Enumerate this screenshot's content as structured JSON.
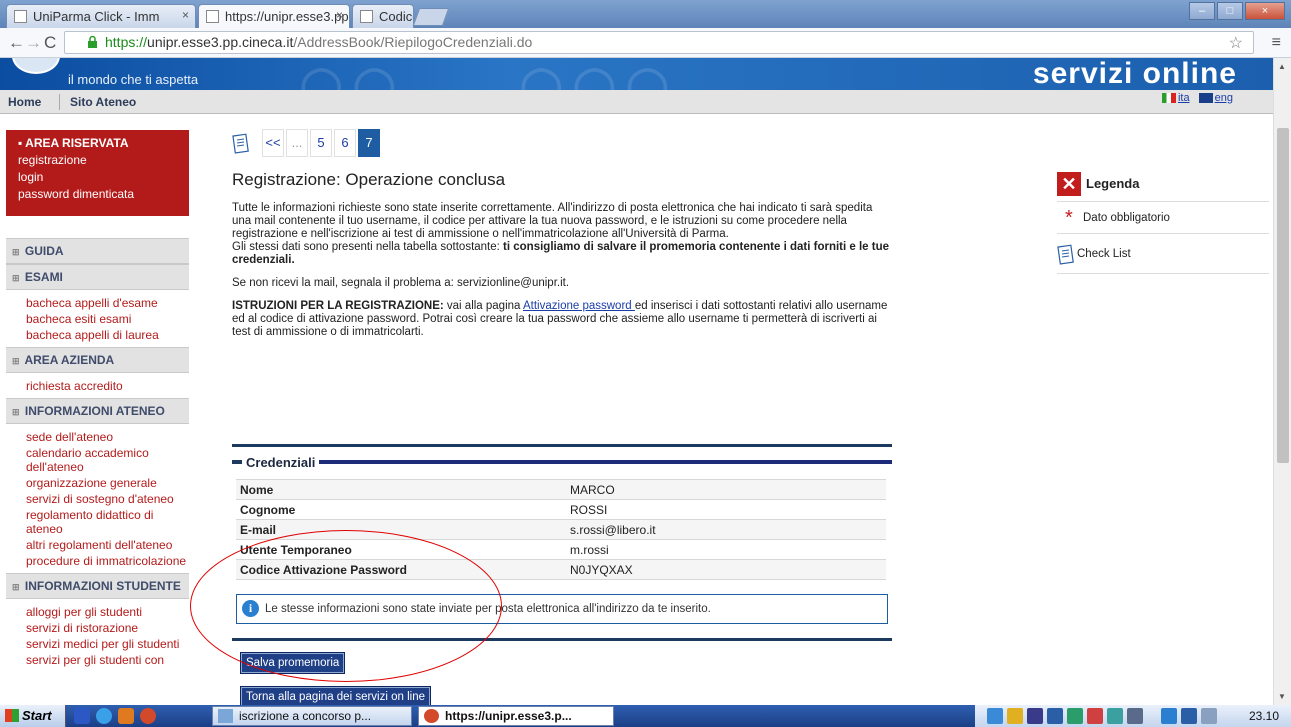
{
  "browser": {
    "tabs": [
      {
        "label": "UniParma Click - Imm",
        "active": false
      },
      {
        "label": "https://unipr.esse3.pp",
        "active": true
      },
      {
        "label": "CodiceFiscale.com -",
        "active": false
      }
    ],
    "url_scheme": "https://",
    "url_host": "unipr.esse3.pp.cineca.it",
    "url_path": "/AddressBook/RiepilogoCredenziali.do"
  },
  "banner": {
    "tagline": "il mondo che ti aspetta",
    "brand": "servizi online"
  },
  "topmenu": {
    "home": "Home",
    "sito": "Sito Ateneo",
    "lang_it": "ita",
    "lang_en": "eng"
  },
  "sidebar": {
    "area_riservata": {
      "title": "AREA RISERVATA",
      "links": [
        "registrazione",
        "login",
        "password dimenticata"
      ]
    },
    "sections": [
      {
        "title": "GUIDA",
        "links": []
      },
      {
        "title": "ESAMI",
        "links": [
          "bacheca appelli d'esame",
          "bacheca esiti esami",
          "bacheca appelli di laurea"
        ]
      },
      {
        "title": "AREA AZIENDA",
        "links": [
          "richiesta accredito"
        ]
      },
      {
        "title": "INFORMAZIONI ATENEO",
        "links": [
          "sede dell'ateneo",
          "calendario accademico dell'ateneo",
          "organizzazione generale",
          "servizi di sostegno d'ateneo",
          "regolamento didattico di ateneo",
          "altri regolamenti dell'ateneo",
          "procedure di immatricolazione"
        ]
      },
      {
        "title": "INFORMAZIONI STUDENTE",
        "links": [
          "alloggi per gli studenti",
          "servizi di ristorazione",
          "servizi medici per gli studenti",
          "servizi per gli studenti con"
        ]
      }
    ]
  },
  "pager": {
    "prev": "<<",
    "ellipsis": "...",
    "pages": [
      "5",
      "6",
      "7"
    ],
    "current": "7"
  },
  "main": {
    "title": "Registrazione: Operazione conclusa",
    "p1": "Tutte le informazioni richieste sono state inserite correttamente. All'indirizzo di posta elettronica che hai indicato ti sarà spedita una mail contenente il tuo username, il codice per attivare la tua nuova password, e le istruzioni su come procedere nella registrazione e nell'iscrizione ai test di ammissione o nell'immatricolazione all'Università di Parma.",
    "p1b": "Gli stessi dati sono presenti nella tabella sottostante: ",
    "p1b_bold": "ti consigliamo di salvare il promemoria contenente i dati forniti e le tue credenziali.",
    "p2": "Se non ricevi la mail, segnala il problema a: servizionline@unipr.it.",
    "p3_bold": "ISTRUZIONI PER LA REGISTRAZIONE:",
    "p3_a": " vai alla pagina ",
    "p3_link": "Attivazione password ",
    "p3_b": "ed inserisci i dati sottostanti relativi allo username ed al codice di attivazione password. Potrai così creare la tua password che assieme allo username ti permetterà di iscriverti ai test di ammissione o di immatricolarti."
  },
  "credentials": {
    "title": "Credenziali",
    "rows": [
      {
        "key": "Nome",
        "value": "MARCO"
      },
      {
        "key": "Cognome",
        "value": "ROSSI"
      },
      {
        "key": "E-mail",
        "value": "s.rossi@libero.it"
      },
      {
        "key": "Utente Temporaneo",
        "value": "m.rossi"
      },
      {
        "key": "Codice Attivazione Password",
        "value": "N0JYQXAX"
      }
    ],
    "info": "Le stesse informazioni sono state inviate per posta elettronica all'indirizzo da te inserito.",
    "btn_save": "Salva promemoria",
    "btn_back": "Torna alla pagina dei servizi on line"
  },
  "legend": {
    "title": "Legenda",
    "required": "Dato obbligatorio",
    "checklist": "Check List"
  },
  "taskbar": {
    "start": "Start",
    "items": [
      "iscrizione a concorso p...",
      "https://unipr.esse3.p..."
    ],
    "clock": "23.10"
  },
  "colors": {
    "accent_red": "#b31b1b",
    "accent_blue": "#1f5da3",
    "annotation": "#e00000"
  }
}
